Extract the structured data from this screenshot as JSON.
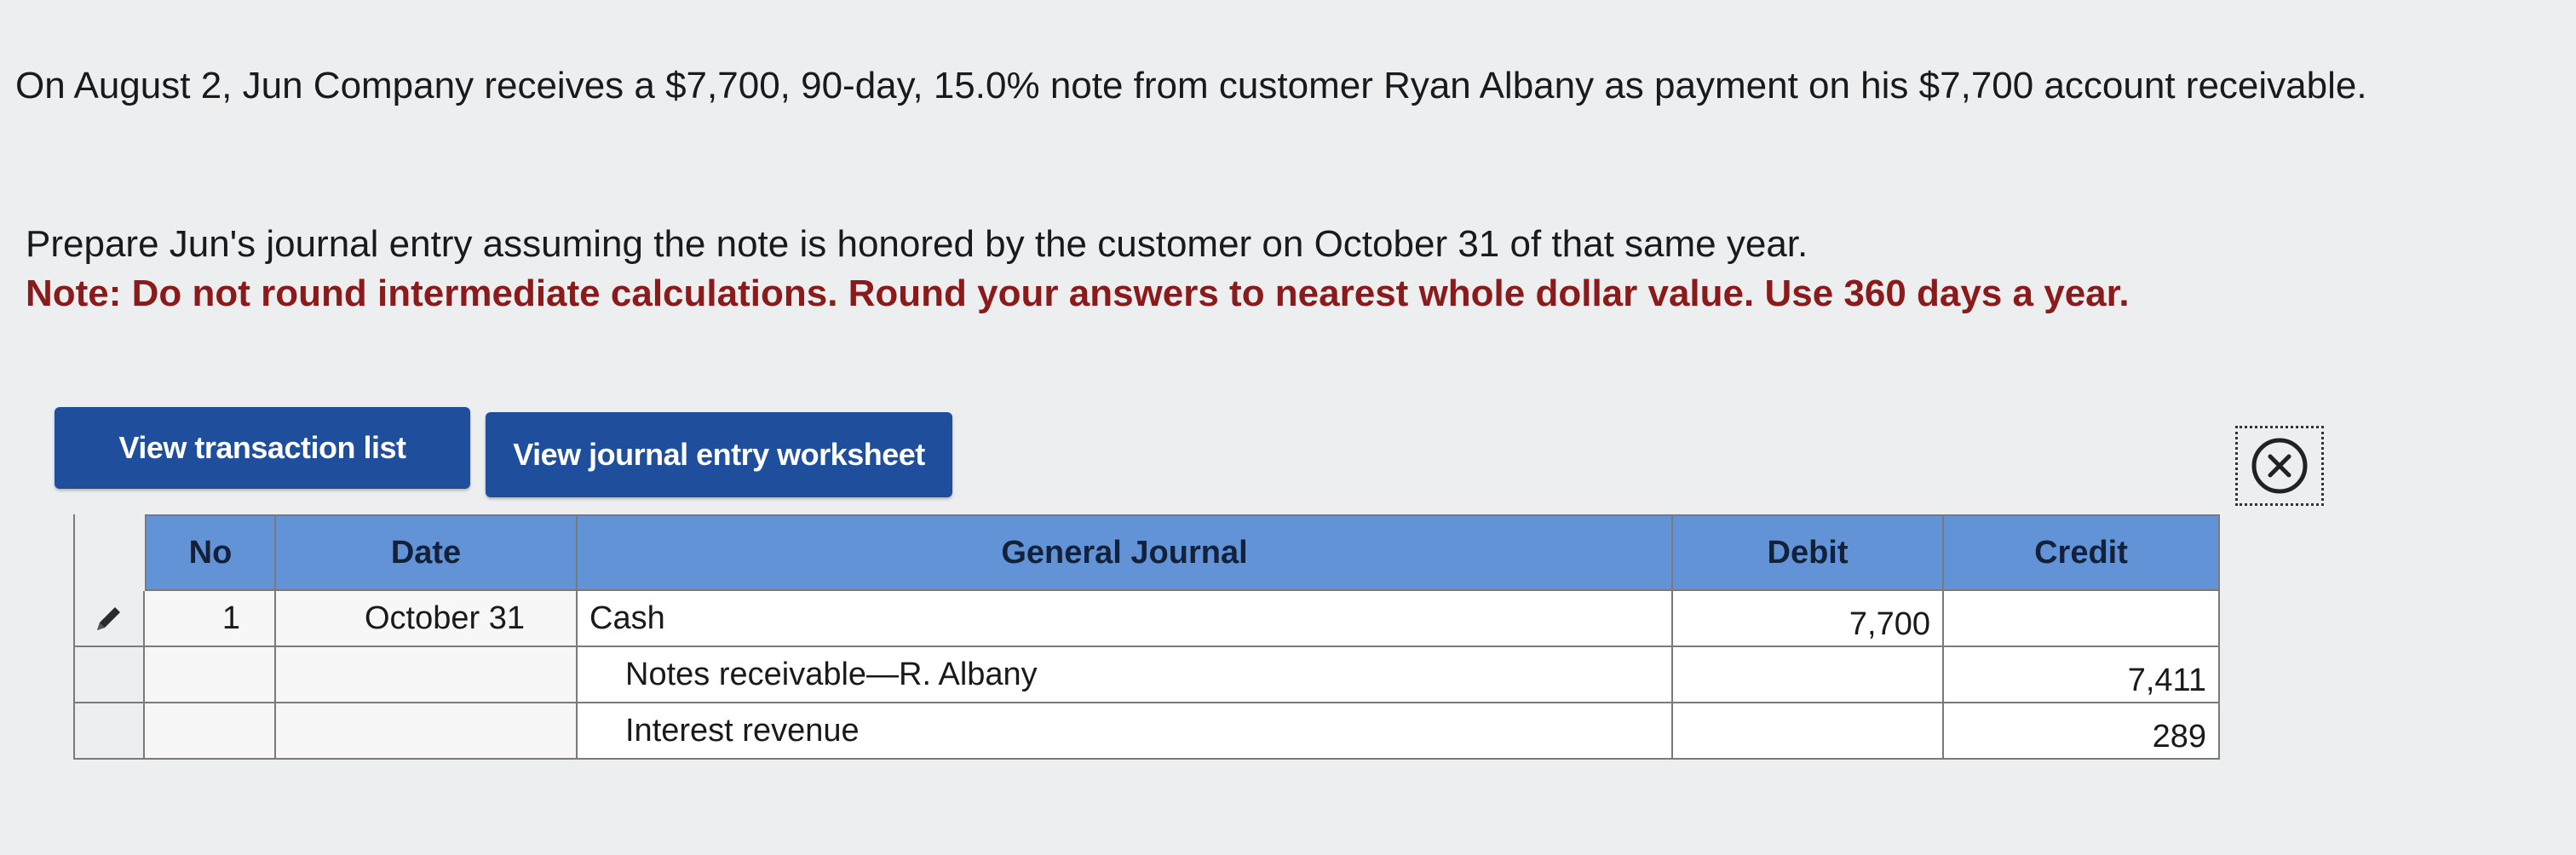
{
  "question": {
    "text": "On August 2, Jun Company receives a $7,700, 90-day, 15.0% note from customer Ryan Albany as payment on his $7,700 account receivable."
  },
  "instruction": {
    "text": "Prepare Jun's journal entry assuming the note is honored by the customer on October 31 of that same year.",
    "note": "Note: Do not round intermediate calculations. Round your answers to nearest whole dollar value. Use 360 days a year."
  },
  "buttons": {
    "view_transactions": "View transaction list",
    "view_worksheet": "View journal entry worksheet"
  },
  "journal": {
    "headers": {
      "no": "No",
      "date": "Date",
      "account": "General Journal",
      "debit": "Debit",
      "credit": "Credit"
    },
    "rows": [
      {
        "no": "1",
        "date": "October 31",
        "account": "Cash",
        "debit": "7,700",
        "credit": ""
      },
      {
        "no": "",
        "date": "",
        "account": "Notes receivable—R. Albany",
        "debit": "",
        "credit": "7,411"
      },
      {
        "no": "",
        "date": "",
        "account": "Interest revenue",
        "debit": "",
        "credit": "289"
      }
    ]
  },
  "icons": {
    "edit": "pencil-icon",
    "close": "close-circle-icon"
  },
  "colors": {
    "button_bg": "#1f4f9c",
    "header_bg": "#6293d6",
    "note_text": "#8b1a1a"
  }
}
